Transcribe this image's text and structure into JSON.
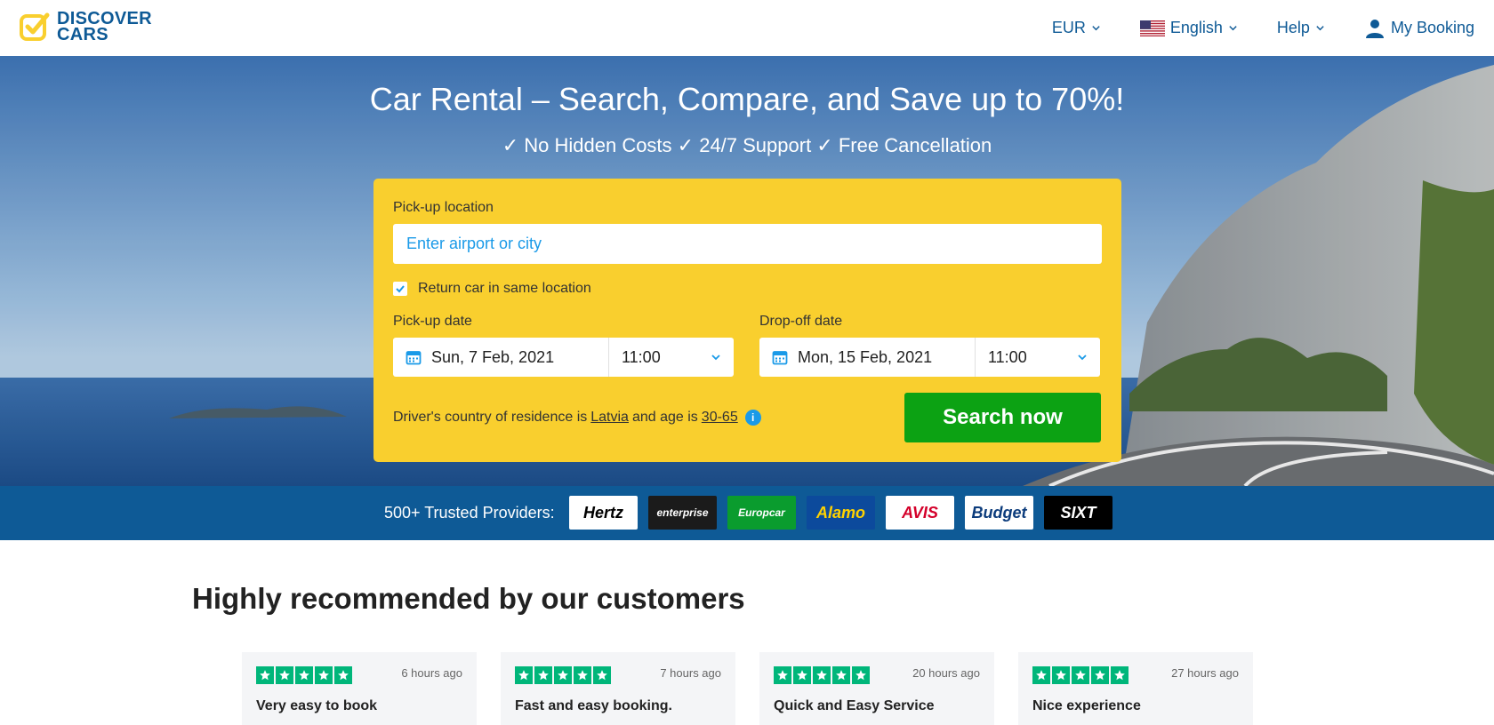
{
  "brand": {
    "line1": "DISCOVER",
    "line2": "CARS"
  },
  "nav": {
    "currency": "EUR",
    "language": "English",
    "help": "Help",
    "my_booking": "My Booking"
  },
  "hero": {
    "title": "Car Rental – Search, Compare, and Save up to 70%!",
    "subtitle": "✓ No Hidden Costs ✓ 24/7 Support ✓ Free Cancellation"
  },
  "search": {
    "pickup_location_label": "Pick-up location",
    "pickup_location_placeholder": "Enter airport or city",
    "pickup_location_value": "",
    "return_same_label": "Return car in same location",
    "return_same_checked": true,
    "pickup_date_label": "Pick-up date",
    "pickup_date": "Sun, 7 Feb, 2021",
    "pickup_time": "11:00",
    "dropoff_date_label": "Drop-off date",
    "dropoff_date": "Mon, 15 Feb, 2021",
    "dropoff_time": "11:00",
    "driver_prefix": "Driver's country of residence is",
    "driver_country": "Latvia",
    "driver_mid": "and age is",
    "driver_age": "30-65",
    "info_glyph": "i",
    "search_button": "Search now"
  },
  "providers": {
    "label": "500+ Trusted Providers:",
    "logos": [
      {
        "name": "Hertz",
        "bg": "#ffffff",
        "color": "#000000"
      },
      {
        "name": "enterprise",
        "bg": "#1b1b1b",
        "color": "#ffffff"
      },
      {
        "name": "Europcar",
        "bg": "#0a9c2e",
        "color": "#ffffff"
      },
      {
        "name": "Alamo",
        "bg": "#0c4a9c",
        "color": "#ffd200"
      },
      {
        "name": "AVIS",
        "bg": "#ffffff",
        "color": "#d4002a"
      },
      {
        "name": "Budget",
        "bg": "#ffffff",
        "color": "#0c3c7c"
      },
      {
        "name": "SIXT",
        "bg": "#000000",
        "color": "#ffffff"
      }
    ]
  },
  "reviews": {
    "heading": "Highly recommended by our customers",
    "rating_color": "#00b67a",
    "cards": [
      {
        "time": "6 hours ago",
        "title": "Very easy to book",
        "stars": 5
      },
      {
        "time": "7 hours ago",
        "title": "Fast and easy booking.",
        "stars": 5
      },
      {
        "time": "20 hours ago",
        "title": "Quick and Easy Service",
        "stars": 5
      },
      {
        "time": "27 hours ago",
        "title": "Nice experience",
        "stars": 5
      }
    ]
  },
  "colors": {
    "brand_blue": "#0e5a96",
    "search_yellow": "#f9cf2e",
    "search_green": "#0ca213",
    "link_blue": "#1a9ae8"
  }
}
